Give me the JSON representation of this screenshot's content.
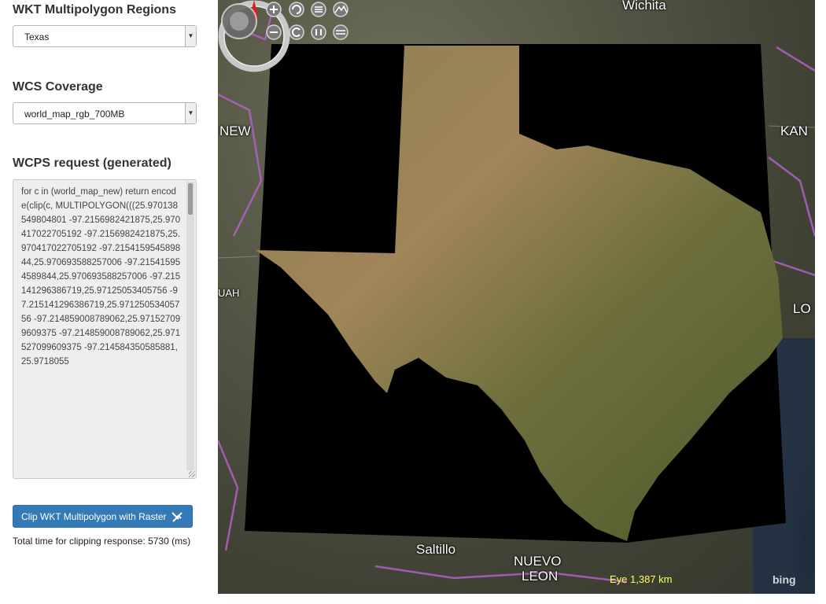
{
  "regions": {
    "heading": "WKT Multipolygon Regions",
    "selected": "Texas"
  },
  "coverage": {
    "heading": "WCS Coverage",
    "selected": "world_map_rgb_700MB"
  },
  "request": {
    "heading": "WCPS request (generated)",
    "text": "for c in (world_map_new) return encode(clip(c, MULTIPOLYGON(((25.970138549804801 -97.2156982421875,25.970417022705192 -97.2156982421875,25.970417022705192 -97.215415954589844,25.970693588257006 -97.215415954589844,25.970693588257006 -97.215141296386719,25.97125053405756 -97.215141296386719,25.97125053405756 -97.214859008789062,25.971527099609375 -97.214859008789062,25.971527099609375 -97.214584350585881,25.9718055"
  },
  "clip_button": {
    "label": "Clip WKT Multipolygon with Raster"
  },
  "status": {
    "text": "Total time for clipping response: 5730 (ms)"
  },
  "map": {
    "labels": {
      "wichita": "Wichita",
      "new": "NEW",
      "kan": "KAN",
      "uah": "UAH",
      "lo": "LO",
      "saltillo": "Saltillo",
      "nuevo": "NUEVO",
      "leon": "LEON"
    },
    "eye_readout": "Eye  1,387 km",
    "attribution": "bing",
    "colors": {
      "texas": "#7a6b3c",
      "roads": "#b260c8",
      "mask": "#000000"
    },
    "icons": [
      "compass-icon",
      "zoom-in-icon",
      "zoom-out-icon",
      "rotate-left-icon",
      "reset-icon",
      "tilt-icon",
      "tilt-reset-icon",
      "terrain-icon",
      "pause-icon",
      "satellite-icon"
    ]
  }
}
